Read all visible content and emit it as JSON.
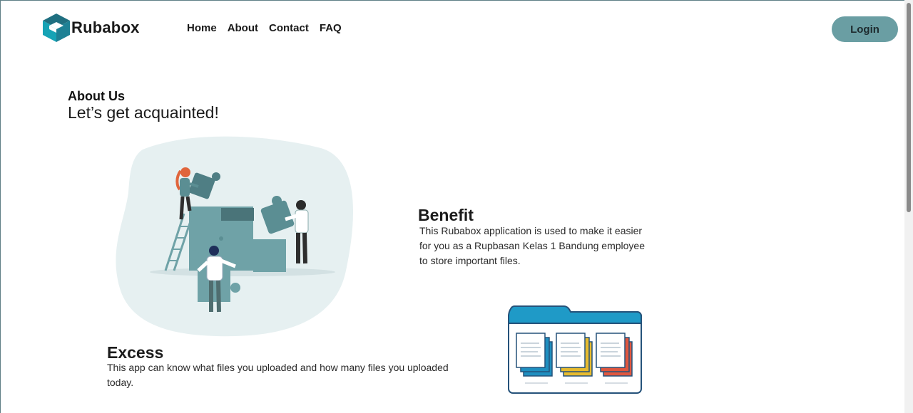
{
  "header": {
    "brand": "Rubabox",
    "nav": [
      "Home",
      "About",
      "Contact",
      "FAQ"
    ],
    "login_label": "Login"
  },
  "about": {
    "label": "About Us",
    "subtitle": "Let’s get acquainted!"
  },
  "benefit": {
    "title": "Benefit",
    "text": "This Rubabox application is used to make it easier for you as a Rupbasan Kelas 1 Bandung employee to store important files."
  },
  "excess": {
    "title": "Excess",
    "text": "This app can know what files you uploaded and how many files you uploaded today."
  },
  "colors": {
    "accent": "#6a9ea3",
    "brand_dark": "#1b6f80",
    "puzzle": "#6fa2a7",
    "blob": "#e6f0f1",
    "folder_blue": "#1f9ac7",
    "doc_blue": "#1f8fc0",
    "doc_yellow": "#e7bb2e",
    "doc_red": "#e0573f"
  },
  "icons": {
    "logo": "cube-box-icon",
    "illustration": "team-puzzle-illustration",
    "folder": "folder-documents-illustration"
  }
}
